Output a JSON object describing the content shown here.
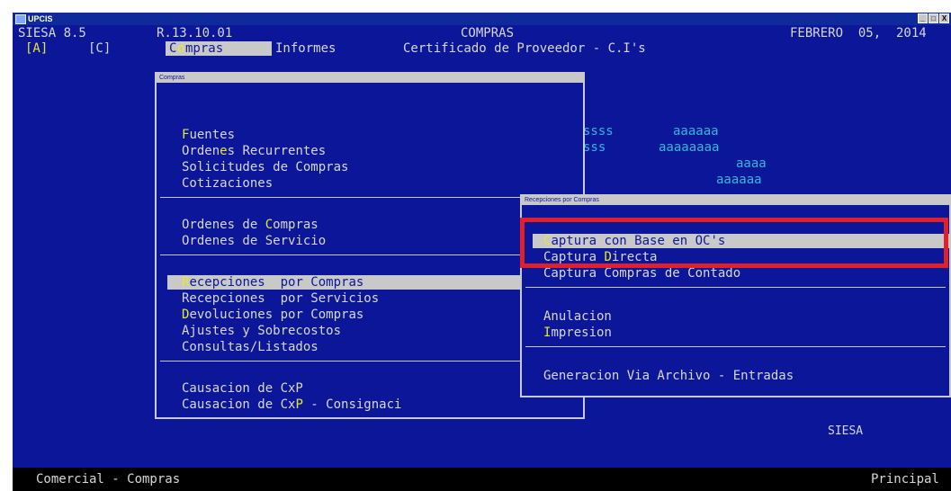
{
  "window": {
    "app_name": "UPCIS",
    "buttons": [
      "_",
      "□",
      "X"
    ]
  },
  "header": {
    "product": "SIESA 8.5",
    "release": "R.13.10.01",
    "module": "COMPRAS",
    "date": "FEBRERO  05,  2014"
  },
  "menubar": {
    "keys": [
      "[A]",
      "[C]"
    ],
    "items": [
      {
        "hotkey": "o",
        "prefix": "C",
        "rest": "mpras"
      },
      {
        "label": "Informes"
      },
      {
        "label": "Certificado de Proveedor - C.I's"
      }
    ]
  },
  "background_text": {
    "line1": [
      "ssss",
      "aaaaaa"
    ],
    "line2": [
      "sss",
      "aaaaaaaa"
    ],
    "line3": "aaaa",
    "line4": "aaaaaa"
  },
  "compras_menu": {
    "title": "Compras",
    "groups": [
      [
        {
          "pre": "",
          "hot": "F",
          "post": "uentes"
        },
        {
          "pre": "Orden",
          "hot": "e",
          "post": "s Recurrentes"
        },
        {
          "pre": "Solicitudes de Compras",
          "hot": "",
          "post": ""
        },
        {
          "pre": "Cotizaciones",
          "hot": "",
          "post": ""
        }
      ],
      [
        {
          "pre": "Ordenes de ",
          "hot": "C",
          "post": "ompras"
        },
        {
          "pre": "Ordenes de Servicio",
          "hot": "",
          "post": ""
        }
      ],
      [
        {
          "pre": "",
          "hot": "R",
          "post": "ecepciones  por Compras",
          "selected": true
        },
        {
          "pre": "Recepciones  por Servicios",
          "hot": "",
          "post": ""
        },
        {
          "pre": "",
          "hot": "D",
          "post": "evoluciones por Compras"
        },
        {
          "pre": "Ajustes y Sobrecostos",
          "hot": "",
          "post": ""
        },
        {
          "pre": "Consultas/Listados",
          "hot": "",
          "post": ""
        }
      ],
      [
        {
          "pre": "Causacion de CxP",
          "hot": "",
          "post": ""
        },
        {
          "pre": "Causacion de Cx",
          "hot": "P",
          "post": " - Consignaci"
        }
      ]
    ]
  },
  "recepciones_menu": {
    "title": "Recepciones por Compras",
    "groups": [
      [
        {
          "pre": "",
          "hot": "C",
          "post": "aptura con Base en OC's",
          "selected": true
        },
        {
          "pre": "Captura ",
          "hot": "D",
          "post": "irecta"
        },
        {
          "pre": "Captura Compras de Contado",
          "hot": "",
          "post": ""
        }
      ],
      [
        {
          "pre": "Anulacion",
          "hot": "",
          "post": ""
        },
        {
          "pre": "",
          "hot": "I",
          "post": "mpresion"
        }
      ],
      [
        {
          "pre": "Generacion Via Archivo - Entradas",
          "hot": "",
          "post": ""
        }
      ]
    ]
  },
  "watermark": "SIESA",
  "status": {
    "left": "Comercial - Compras",
    "right": "Principal"
  },
  "colors": {
    "screen_bg": "#0b1798",
    "text": "#d7d7d7",
    "hotkey": "#e6e633",
    "highlight": "#c9c9c9",
    "annotation": "#e0202a"
  }
}
